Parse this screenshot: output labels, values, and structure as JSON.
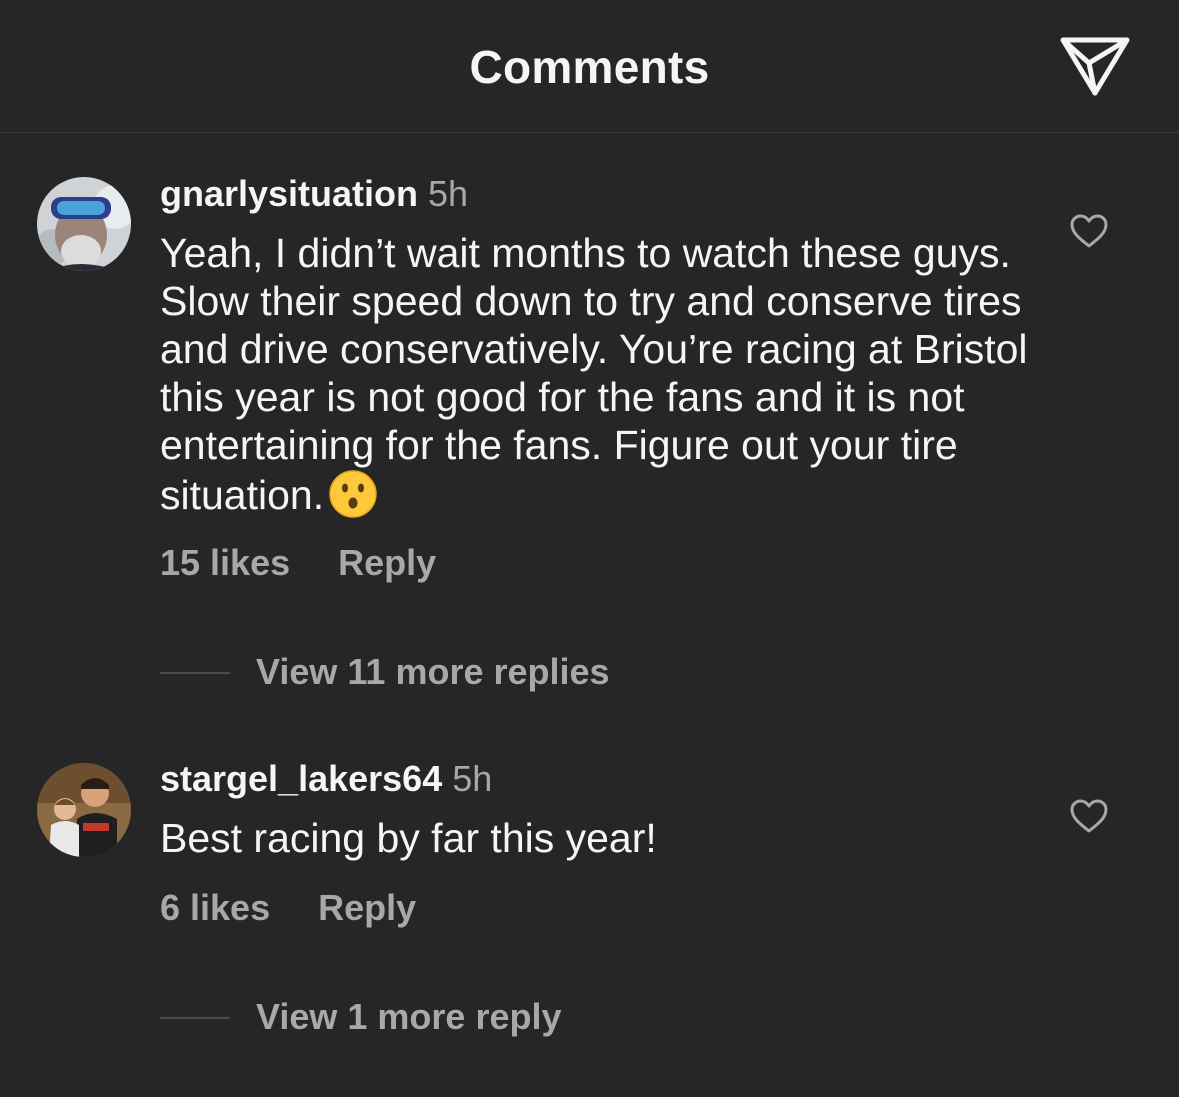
{
  "header": {
    "title": "Comments",
    "share_icon": "paper-plane-icon"
  },
  "comments": [
    {
      "username": "gnarlysituation",
      "time": "5h",
      "text": "Yeah, I didn’t wait months to watch these guys. Slow their speed down to try and conserve tires and drive conservatively. You’re racing at Bristol this year is not good for the fans and it is not entertaining for the fans. Figure out your tire situation.",
      "emoji": "hushed-face-emoji",
      "likes": "15 likes",
      "reply_label": "Reply",
      "view_replies": "View 11 more replies",
      "like_icon": "heart-outline-icon"
    },
    {
      "username": "stargel_lakers64",
      "time": "5h",
      "text": "Best racing by far this year!",
      "likes": "6 likes",
      "reply_label": "Reply",
      "view_replies": "View 1 more reply",
      "like_icon": "heart-outline-icon"
    }
  ],
  "colors": {
    "background": "#262626",
    "primary_text": "#f5f5f5",
    "secondary_text": "#a8a8a8",
    "divider": "#3a3a3a"
  }
}
